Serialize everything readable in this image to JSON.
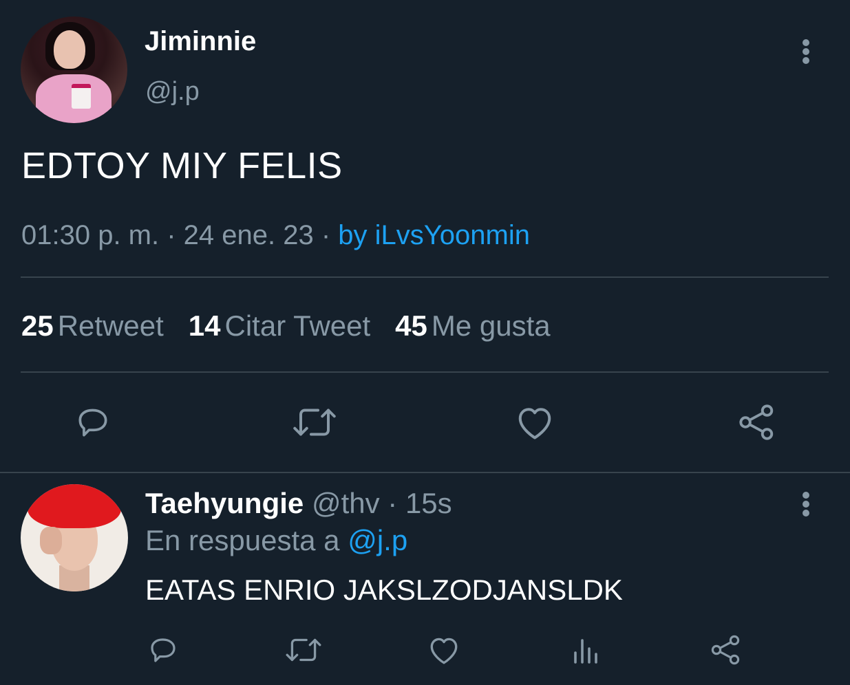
{
  "tweet": {
    "display_name": "Jiminnie",
    "handle": "@j.p",
    "text": "EDTOY MIY FELIS",
    "time": "01:30 p. m.",
    "sep1": " · ",
    "date": "24 ene. 23",
    "sep2": " · ",
    "source": "by iLvsYoonmin",
    "stats": [
      {
        "count": "25",
        "label": "Retweet"
      },
      {
        "count": "14",
        "label": "Citar Tweet"
      },
      {
        "count": "45",
        "label": "Me gusta"
      }
    ],
    "actions": [
      "reply-icon",
      "retweet-icon",
      "like-icon",
      "share-icon"
    ]
  },
  "reply": {
    "display_name": "Taehyungie",
    "handle": "@thv",
    "sep": " · ",
    "time": "15s",
    "in_reply_prefix": "En respuesta a ",
    "in_reply_mention": "@j.p",
    "text": "EATAS ENRIO JAKSLZODJANSLDK",
    "actions": [
      "reply-icon",
      "retweet-icon",
      "like-icon",
      "analytics-icon",
      "share-icon"
    ]
  },
  "colors": {
    "background": "#15202b",
    "secondary_text": "#8899a6",
    "link": "#1da1f2",
    "divider": "#38444d"
  }
}
